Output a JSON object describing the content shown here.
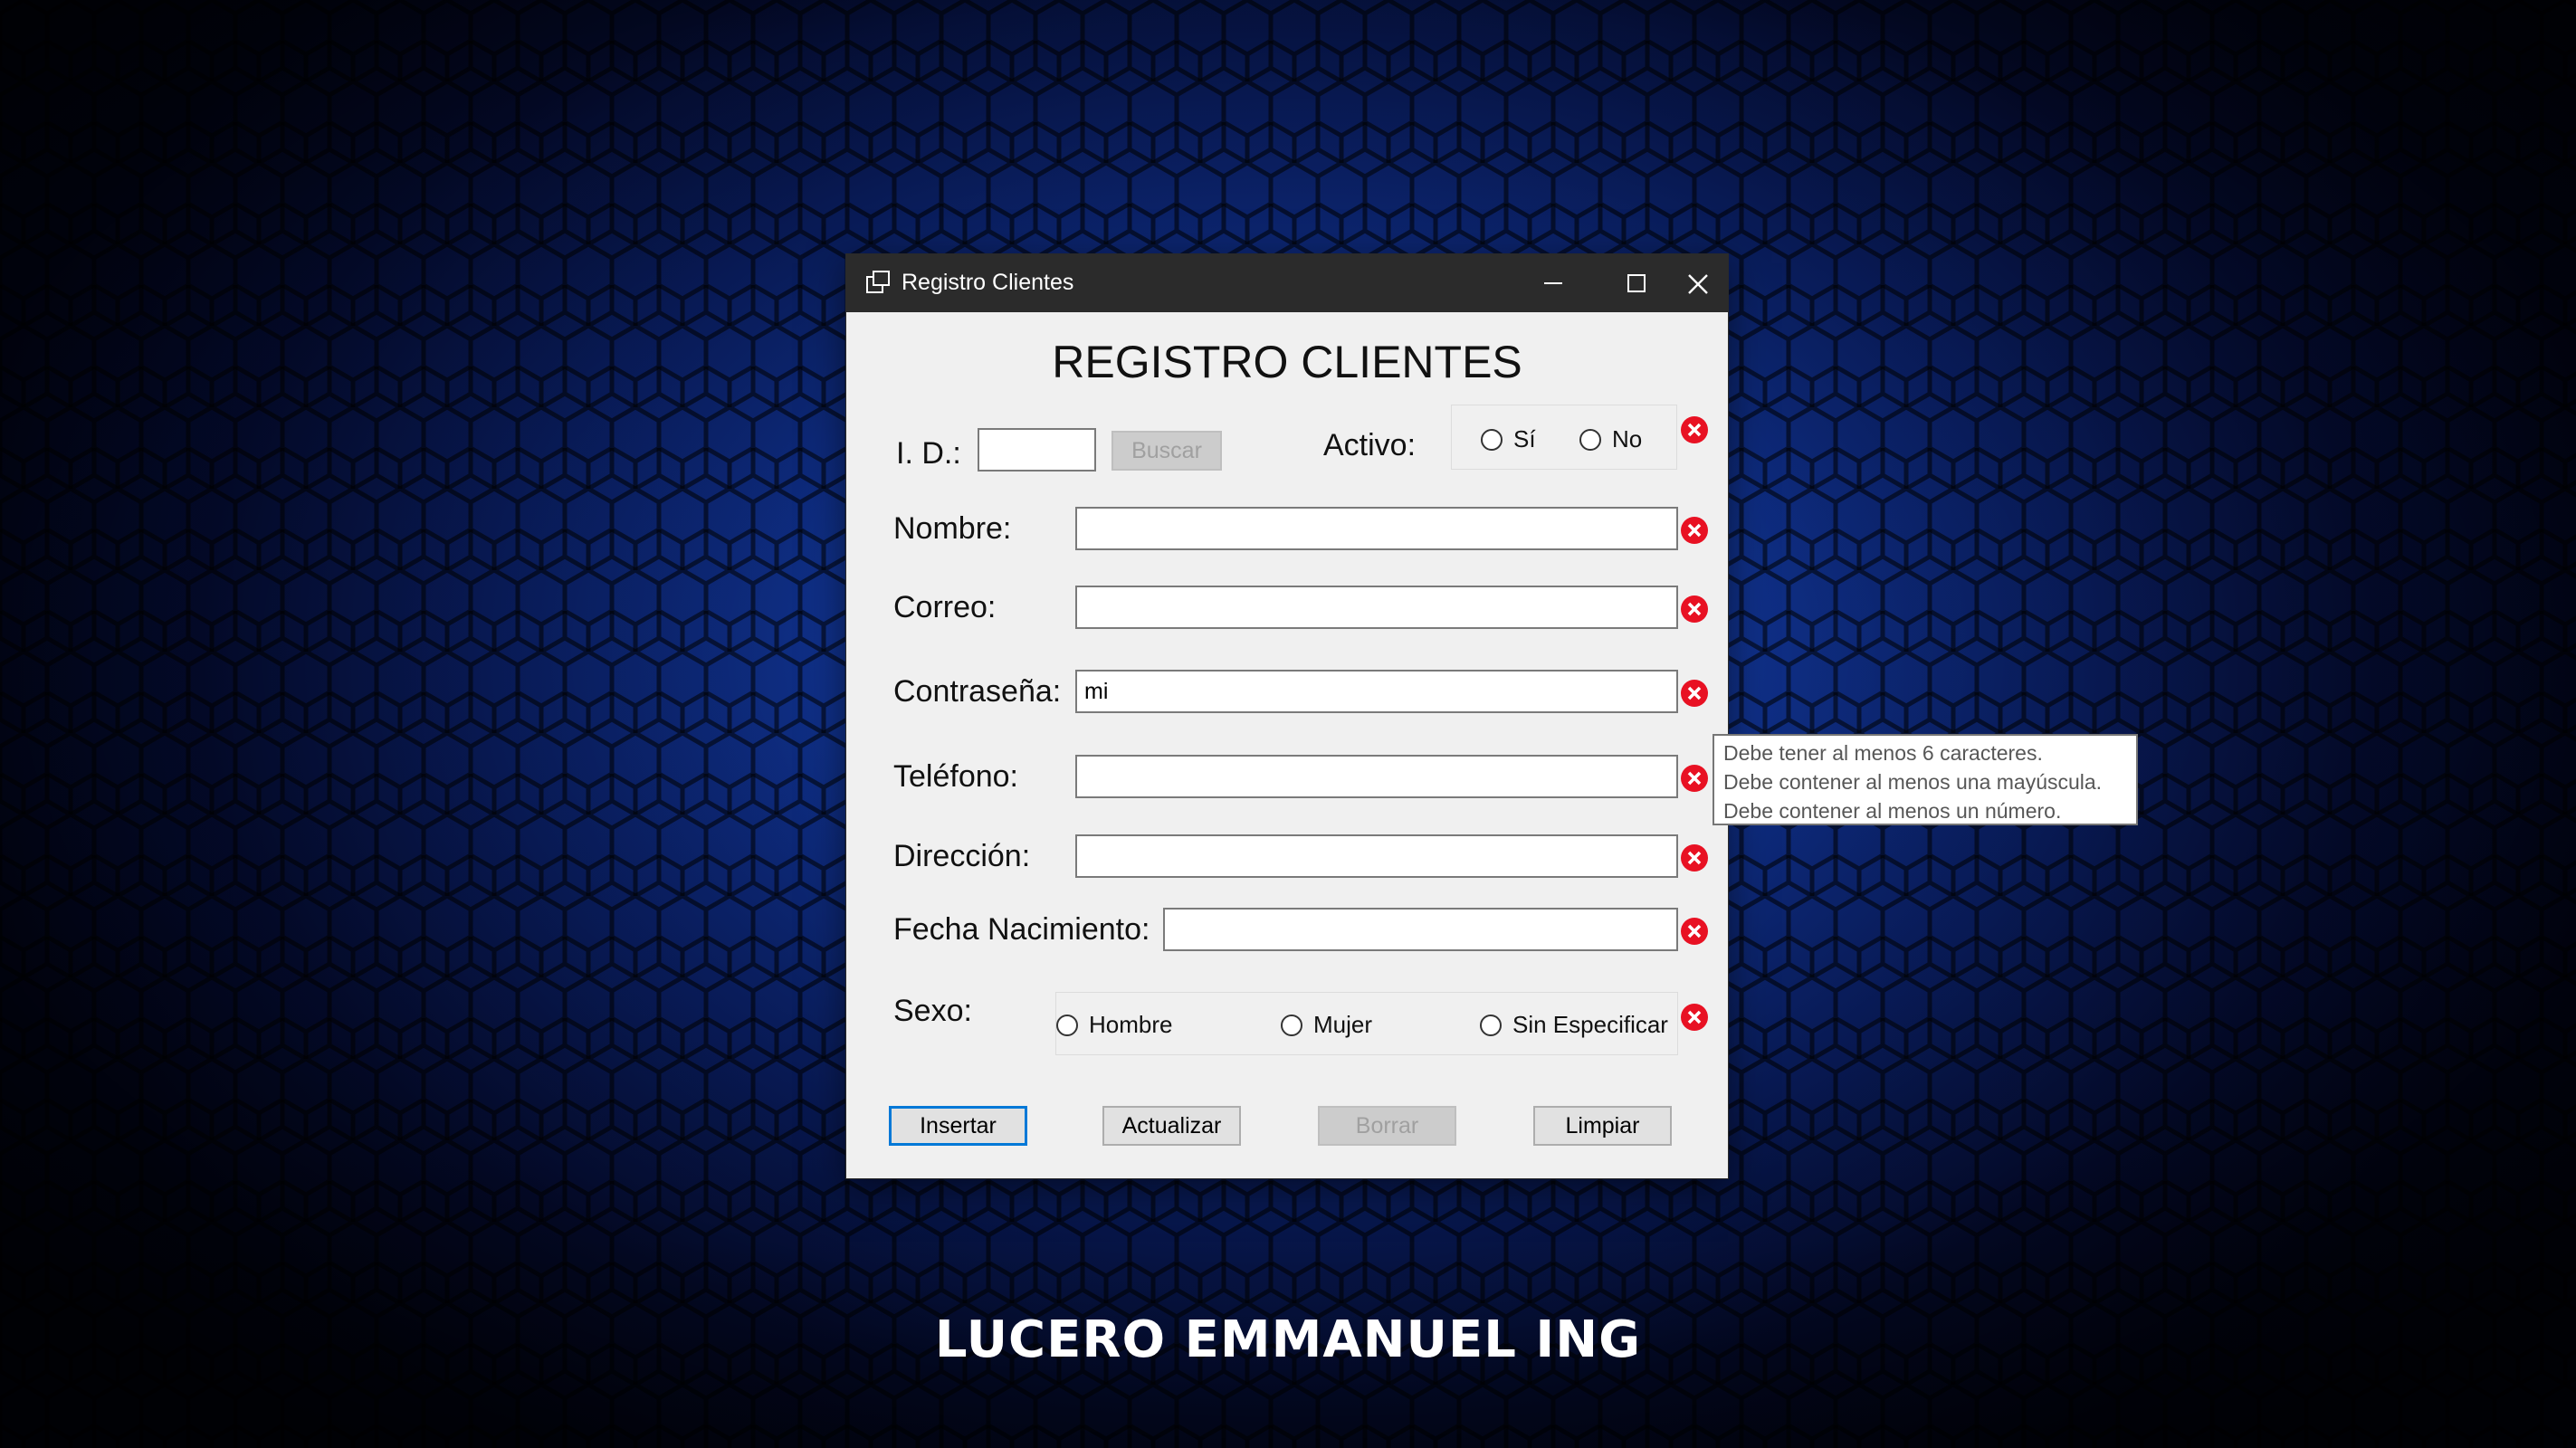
{
  "window": {
    "title": "Registro Clientes",
    "icon": "form-window-icon",
    "controls": {
      "minimize": "minimize-icon",
      "maximize": "maximize-icon",
      "close": "close-icon"
    }
  },
  "form": {
    "title": "REGISTRO CLIENTES",
    "id": {
      "label": "I. D.:",
      "value": "",
      "search_button": "Buscar"
    },
    "activo": {
      "label": "Activo:",
      "options": [
        "Sí",
        "No"
      ]
    },
    "nombre": {
      "label": "Nombre:",
      "value": ""
    },
    "correo": {
      "label": "Correo:",
      "value": ""
    },
    "contrasena": {
      "label": "Contraseña:",
      "value": "mi"
    },
    "telefono": {
      "label": "Teléfono:",
      "value": ""
    },
    "direccion": {
      "label": "Dirección:",
      "value": ""
    },
    "fecha": {
      "label": "Fecha Nacimiento:",
      "value": ""
    },
    "sexo": {
      "label": "Sexo:",
      "options": [
        "Hombre",
        "Mujer",
        "Sin Especificar"
      ]
    },
    "buttons": {
      "insertar": "Insertar",
      "actualizar": "Actualizar",
      "borrar": "Borrar",
      "limpiar": "Limpiar"
    }
  },
  "tooltip": {
    "lines": [
      "Debe tener al menos 6 caracteres.",
      "Debe contener al menos una mayúscula.",
      "Debe contener al menos un número."
    ]
  },
  "branding": {
    "text": "LUCERO EMMANUEL ING"
  },
  "colors": {
    "background_glow": "#1b4fd0",
    "titlebar": "#2b2b2b",
    "error_icon": "#e81123",
    "default_button_border": "#0078d7"
  }
}
